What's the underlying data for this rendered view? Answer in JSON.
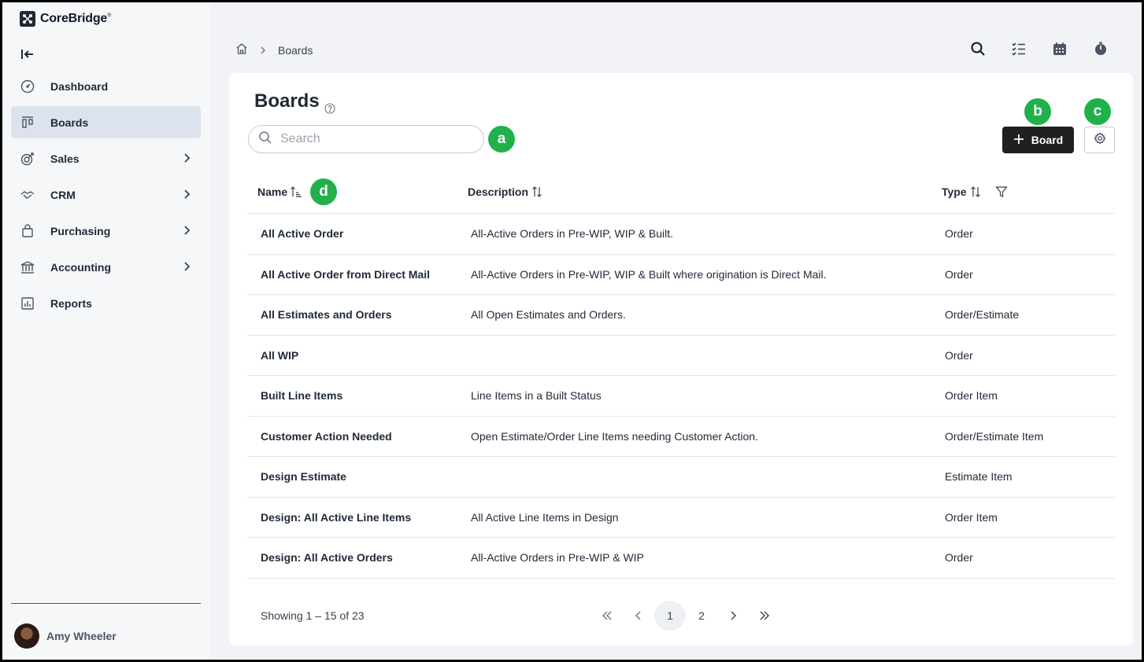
{
  "app": {
    "name": "CoreBridge"
  },
  "sidebar": {
    "items": [
      {
        "label": "Dashboard",
        "icon": "dashboard-icon",
        "active": false,
        "has_children": false
      },
      {
        "label": "Boards",
        "icon": "boards-icon",
        "active": true,
        "has_children": false
      },
      {
        "label": "Sales",
        "icon": "sales-icon",
        "active": false,
        "has_children": true
      },
      {
        "label": "CRM",
        "icon": "crm-icon",
        "active": false,
        "has_children": true
      },
      {
        "label": "Purchasing",
        "icon": "purchasing-icon",
        "active": false,
        "has_children": true
      },
      {
        "label": "Accounting",
        "icon": "accounting-icon",
        "active": false,
        "has_children": true
      },
      {
        "label": "Reports",
        "icon": "reports-icon",
        "active": false,
        "has_children": false
      }
    ],
    "user": {
      "name": "Amy Wheeler"
    }
  },
  "breadcrumb": {
    "current": "Boards"
  },
  "page": {
    "title": "Boards",
    "search_placeholder": "Search",
    "search_value": "",
    "add_label": "Board"
  },
  "annotations": {
    "a": "a",
    "b": "b",
    "c": "c",
    "d": "d"
  },
  "table": {
    "columns": {
      "name": "Name",
      "description": "Description",
      "type": "Type"
    },
    "rows": [
      {
        "name": "All Active Order",
        "description": "All-Active Orders in Pre-WIP, WIP & Built.",
        "type": "Order"
      },
      {
        "name": "All Active Order from Direct Mail",
        "description": "All-Active Orders in Pre-WIP, WIP & Built where origination is Direct Mail.",
        "type": "Order"
      },
      {
        "name": "All Estimates and Orders",
        "description": "All Open Estimates and Orders.",
        "type": "Order/Estimate"
      },
      {
        "name": "All WIP",
        "description": "",
        "type": "Order"
      },
      {
        "name": "Built Line Items",
        "description": "Line Items in a Built Status",
        "type": "Order Item"
      },
      {
        "name": "Customer Action Needed",
        "description": "Open Estimate/Order Line Items needing Customer Action.",
        "type": "Order/Estimate Item"
      },
      {
        "name": "Design Estimate",
        "description": "",
        "type": "Estimate Item"
      },
      {
        "name": "Design: All Active Line Items",
        "description": "All Active Line Items in Design",
        "type": "Order Item"
      },
      {
        "name": "Design: All Active Orders",
        "description": "All-Active Orders in Pre-WIP & WIP",
        "type": "Order"
      }
    ]
  },
  "pagination": {
    "showing": "Showing 1 – 15 of 23",
    "pages": [
      "1",
      "2"
    ],
    "current": "1"
  },
  "colors": {
    "accent_green": "#22b04b",
    "primary_button": "#1f2022",
    "active_nav": "#dde3ec"
  }
}
